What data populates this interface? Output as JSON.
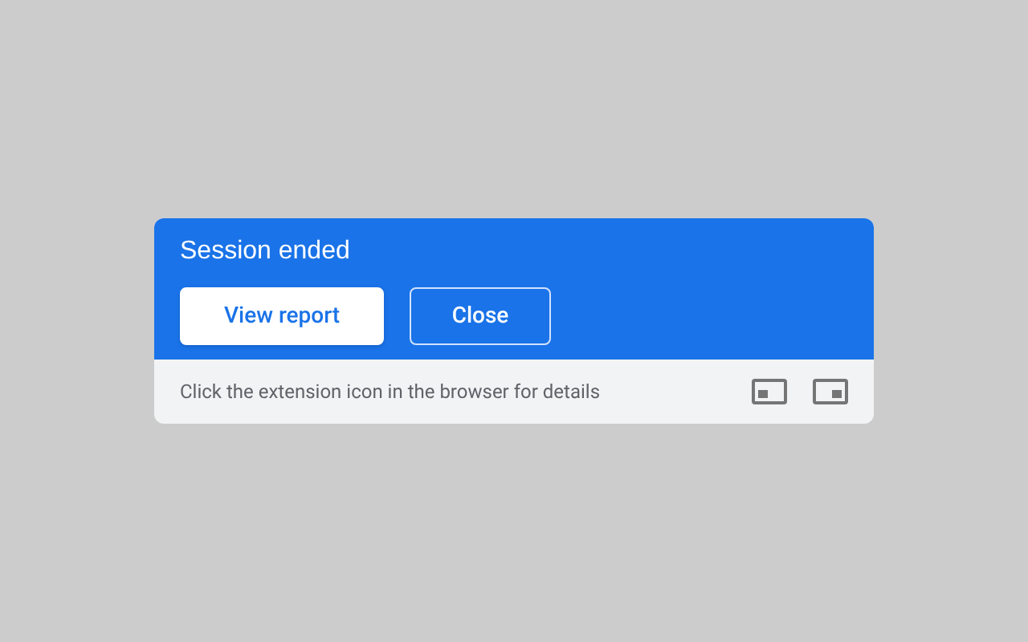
{
  "dialog": {
    "title": "Session ended",
    "buttons": [
      {
        "label": "View report",
        "kind": "filled"
      },
      {
        "label": "Close",
        "kind": "outlined"
      }
    ],
    "footer": {
      "hint": "Click the extension icon in the browser for details"
    }
  }
}
